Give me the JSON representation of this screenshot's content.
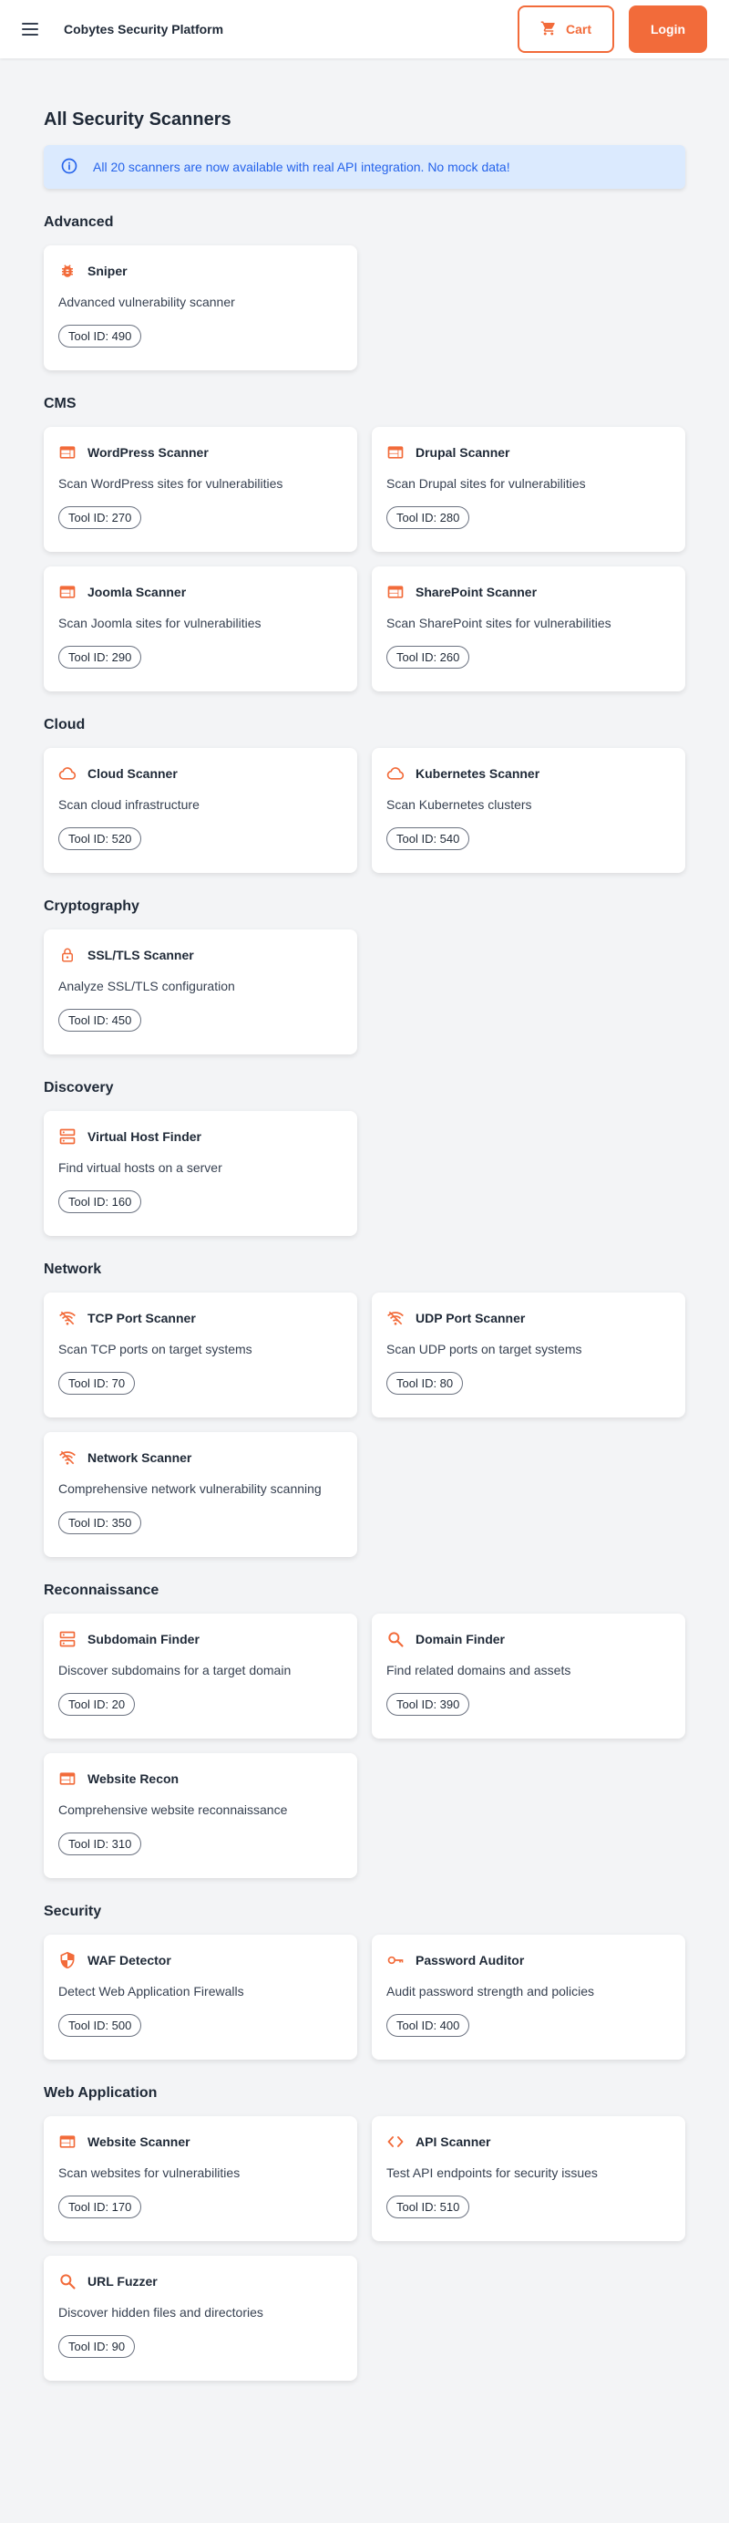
{
  "header": {
    "title": "Cobytes Security Platform",
    "cart_label": "Cart",
    "login_label": "Login"
  },
  "page": {
    "title": "All Security Scanners",
    "info": "All 20 scanners are now available with real API integration. No mock data!"
  },
  "colors": {
    "accent": "#f26b3a",
    "info_bg": "#dbeafe",
    "info_text": "#2563eb"
  },
  "categories": [
    {
      "name": "Advanced",
      "tools": [
        {
          "name": "Sniper",
          "description": "Advanced vulnerability scanner",
          "badge": "Tool ID: 490",
          "icon": "bug-icon"
        }
      ]
    },
    {
      "name": "CMS",
      "tools": [
        {
          "name": "WordPress Scanner",
          "description": "Scan WordPress sites for vulnerabilities",
          "badge": "Tool ID: 270",
          "icon": "web-icon"
        },
        {
          "name": "Drupal Scanner",
          "description": "Scan Drupal sites for vulnerabilities",
          "badge": "Tool ID: 280",
          "icon": "web-icon"
        },
        {
          "name": "Joomla Scanner",
          "description": "Scan Joomla sites for vulnerabilities",
          "badge": "Tool ID: 290",
          "icon": "web-icon"
        },
        {
          "name": "SharePoint Scanner",
          "description": "Scan SharePoint sites for vulnerabilities",
          "badge": "Tool ID: 260",
          "icon": "web-icon"
        }
      ]
    },
    {
      "name": "Cloud",
      "tools": [
        {
          "name": "Cloud Scanner",
          "description": "Scan cloud infrastructure",
          "badge": "Tool ID: 520",
          "icon": "cloud-icon"
        },
        {
          "name": "Kubernetes Scanner",
          "description": "Scan Kubernetes clusters",
          "badge": "Tool ID: 540",
          "icon": "cloud-icon"
        }
      ]
    },
    {
      "name": "Cryptography",
      "tools": [
        {
          "name": "SSL/TLS Scanner",
          "description": "Analyze SSL/TLS configuration",
          "badge": "Tool ID: 450",
          "icon": "lock-icon"
        }
      ]
    },
    {
      "name": "Discovery",
      "tools": [
        {
          "name": "Virtual Host Finder",
          "description": "Find virtual hosts on a server",
          "badge": "Tool ID: 160",
          "icon": "server-icon"
        }
      ]
    },
    {
      "name": "Network",
      "tools": [
        {
          "name": "TCP Port Scanner",
          "description": "Scan TCP ports on target systems",
          "badge": "Tool ID: 70",
          "icon": "network-icon"
        },
        {
          "name": "UDP Port Scanner",
          "description": "Scan UDP ports on target systems",
          "badge": "Tool ID: 80",
          "icon": "network-icon"
        },
        {
          "name": "Network Scanner",
          "description": "Comprehensive network vulnerability scanning",
          "badge": "Tool ID: 350",
          "icon": "network-icon"
        }
      ]
    },
    {
      "name": "Reconnaissance",
      "tools": [
        {
          "name": "Subdomain Finder",
          "description": "Discover subdomains for a target domain",
          "badge": "Tool ID: 20",
          "icon": "server-icon"
        },
        {
          "name": "Domain Finder",
          "description": "Find related domains and assets",
          "badge": "Tool ID: 390",
          "icon": "search-icon"
        },
        {
          "name": "Website Recon",
          "description": "Comprehensive website reconnaissance",
          "badge": "Tool ID: 310",
          "icon": "web-icon"
        }
      ]
    },
    {
      "name": "Security",
      "tools": [
        {
          "name": "WAF Detector",
          "description": "Detect Web Application Firewalls",
          "badge": "Tool ID: 500",
          "icon": "shield-icon"
        },
        {
          "name": "Password Auditor",
          "description": "Audit password strength and policies",
          "badge": "Tool ID: 400",
          "icon": "key-icon"
        }
      ]
    },
    {
      "name": "Web Application",
      "tools": [
        {
          "name": "Website Scanner",
          "description": "Scan websites for vulnerabilities",
          "badge": "Tool ID: 170",
          "icon": "web-icon"
        },
        {
          "name": "API Scanner",
          "description": "Test API endpoints for security issues",
          "badge": "Tool ID: 510",
          "icon": "code-icon"
        },
        {
          "name": "URL Fuzzer",
          "description": "Discover hidden files and directories",
          "badge": "Tool ID: 90",
          "icon": "search-icon"
        }
      ]
    }
  ]
}
